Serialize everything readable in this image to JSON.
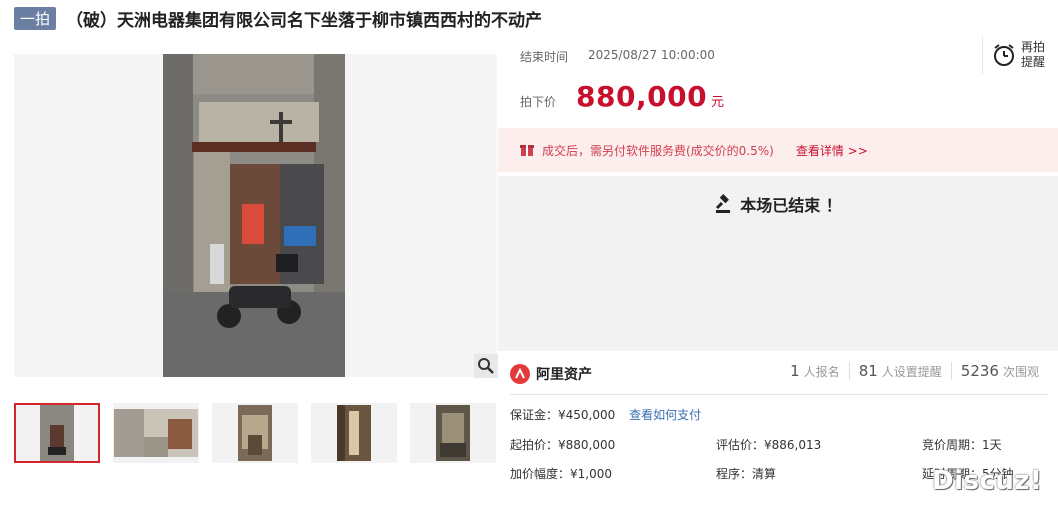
{
  "header": {
    "round_tag": "一拍",
    "title": "（破）天洲电器集团有限公司名下坐落于柳市镇西西村的不动产"
  },
  "auction": {
    "end_label": "结束时间",
    "end_value": "2025/08/27 10:00:00",
    "price_label": "拍下价",
    "price_value": "880,000",
    "price_unit": "元",
    "remind_line1": "再拍",
    "remind_line2": "提醒"
  },
  "fee": {
    "text": "成交后，需另付软件服务费(成交价的0.5%)",
    "link": "查看详情 >>"
  },
  "status": {
    "ended_text": "本场已结束 ！"
  },
  "provider": {
    "name": "阿里资产",
    "stats": [
      {
        "num": "1",
        "label": "人报名"
      },
      {
        "num": "81",
        "label": "人设置提醒"
      },
      {
        "num": "5236",
        "label": "次围观"
      }
    ]
  },
  "details": {
    "deposit": "保证金：¥450,000",
    "deposit_link": "查看如何支付",
    "start_price": "起拍价：¥880,000",
    "appraisal": "评估价：¥886,013",
    "cycle": "竞价周期：1天",
    "increment": "加价幅度：¥1,000",
    "procedure": "程序：清算",
    "delay": "延时周期：5分钟"
  },
  "watermark": "Discuz!",
  "colors": {
    "accent": "#c8102e",
    "tag": "#6b7fa3",
    "fee_bg": "#fdeeee"
  }
}
